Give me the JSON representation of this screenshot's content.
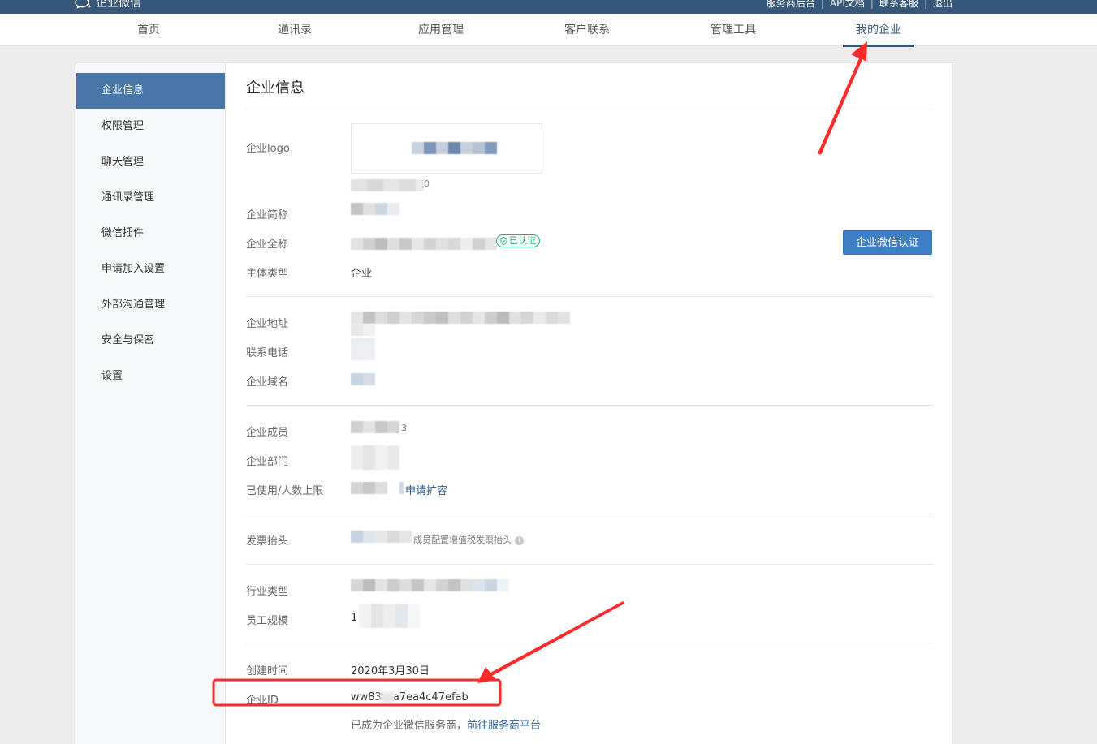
{
  "brand": {
    "name": "企业微信"
  },
  "top_links": [
    "服务商后台",
    "API文档",
    "联系客服",
    "退出"
  ],
  "nav": {
    "items": [
      "首页",
      "通讯录",
      "应用管理",
      "客户联系",
      "管理工具",
      "我的企业"
    ],
    "active": "我的企业"
  },
  "sidebar": {
    "items": [
      "企业信息",
      "权限管理",
      "聊天管理",
      "通讯录管理",
      "微信插件",
      "申请加入设置",
      "外部沟通管理",
      "安全与保密",
      "设置"
    ],
    "active": "企业信息"
  },
  "main": {
    "title": "企业信息",
    "labels": {
      "logo": "企业logo",
      "short_name": "企业简称",
      "full_name": "企业全称",
      "entity_type": "主体类型",
      "address": "企业地址",
      "phone": "联系电话",
      "domain": "企业域名",
      "members": "企业成员",
      "departments": "企业部门",
      "used_limit": "已使用/人数上限",
      "invoice": "发票抬头",
      "industry": "行业类型",
      "scale": "员工规模",
      "created": "创建时间",
      "corp_id": "企业ID"
    },
    "logo_caption_tail": "0",
    "verified_badge": "已认证",
    "verify_button": "企业微信认证",
    "entity_type_value": "企业",
    "member_tail": "3",
    "expand_link": "申请扩容",
    "invoice_hint": "成员配置增值税发票抬头",
    "scale_prefix": "1",
    "created_value": "2020年3月30日",
    "corp_id_value_visible_head": "ww83",
    "corp_id_value_visible_tail": "a7ea4c47efab",
    "provider_note": "已成为企业微信服务商，",
    "provider_link": "前往服务商平台"
  },
  "colors": {
    "topbar": "#35587a",
    "accent": "#4a76aa",
    "button": "#3d7ec4",
    "verified_green": "#1aad6a",
    "annotation_red": "#ff2a2a"
  }
}
